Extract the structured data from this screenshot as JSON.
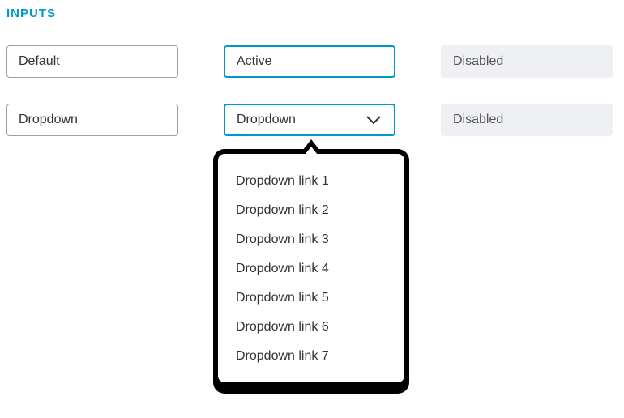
{
  "section_title": "INPUTS",
  "row1": {
    "default_label": "Default",
    "active_label": "Active",
    "disabled_label": "Disabled"
  },
  "row2": {
    "default_label": "Dropdown",
    "active_label": "Dropdown",
    "disabled_label": "Disabled"
  },
  "dropdown_menu": {
    "items": [
      "Dropdown link 1",
      "Dropdown link 2",
      "Dropdown link 3",
      "Dropdown link 4",
      "Dropdown link 5",
      "Dropdown link 6",
      "Dropdown link 7"
    ]
  },
  "colors": {
    "accent": "#0099cc",
    "disabled_bg": "#eef0f4",
    "border": "#9aa0a6",
    "text": "#333"
  }
}
